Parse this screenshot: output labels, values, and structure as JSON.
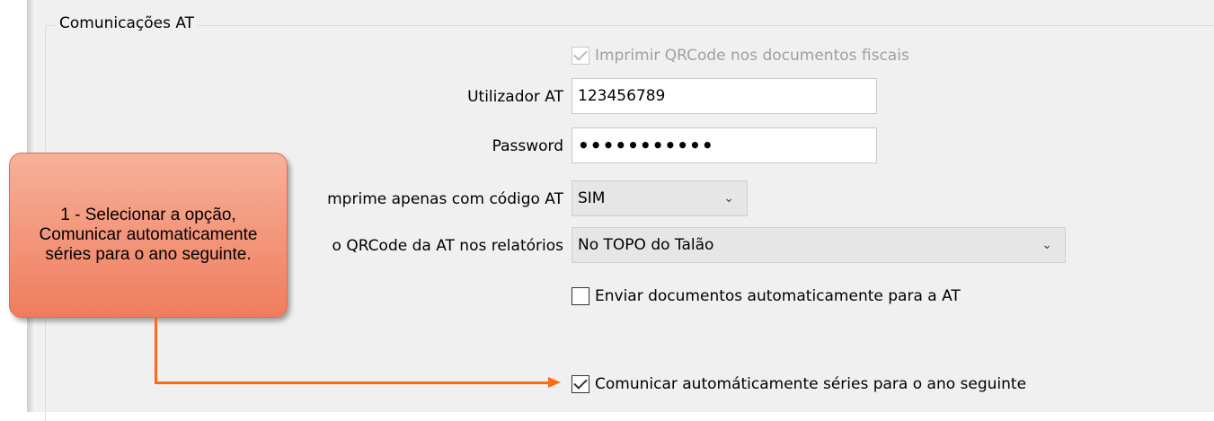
{
  "group": {
    "title": "Comunicações AT"
  },
  "qrcode_fiscal": {
    "label": "Imprimir QRCode nos documentos fiscais",
    "checked": true,
    "disabled": true
  },
  "utilizador": {
    "label": "Utilizador AT",
    "value": "123456789"
  },
  "password": {
    "label": "Password",
    "value": "•••••••••••"
  },
  "imprime_codigo": {
    "label": "Imprime apenas com código AT",
    "visible_label": "mprime apenas com código AT",
    "value": "SIM"
  },
  "qrcode_relatorios": {
    "label": "o QRCode da AT nos relatórios",
    "value": "No TOPO do Talão"
  },
  "enviar_docs": {
    "label": "Enviar documentos automaticamente para a AT",
    "checked": false
  },
  "comunicar_series": {
    "label": "Comunicar automáticamente séries para o ano seguinte",
    "checked": true
  },
  "callout": {
    "text": "1 - Selecionar a opção, Comunicar automaticamente séries para o ano seguinte."
  },
  "colors": {
    "accent_arrow": "#ff6a13",
    "callout_fill": "#f29378",
    "panel_bg": "#f0f0f0"
  },
  "icons": {
    "dropdown": "chevron-down-icon",
    "check": "checkmark-icon"
  }
}
